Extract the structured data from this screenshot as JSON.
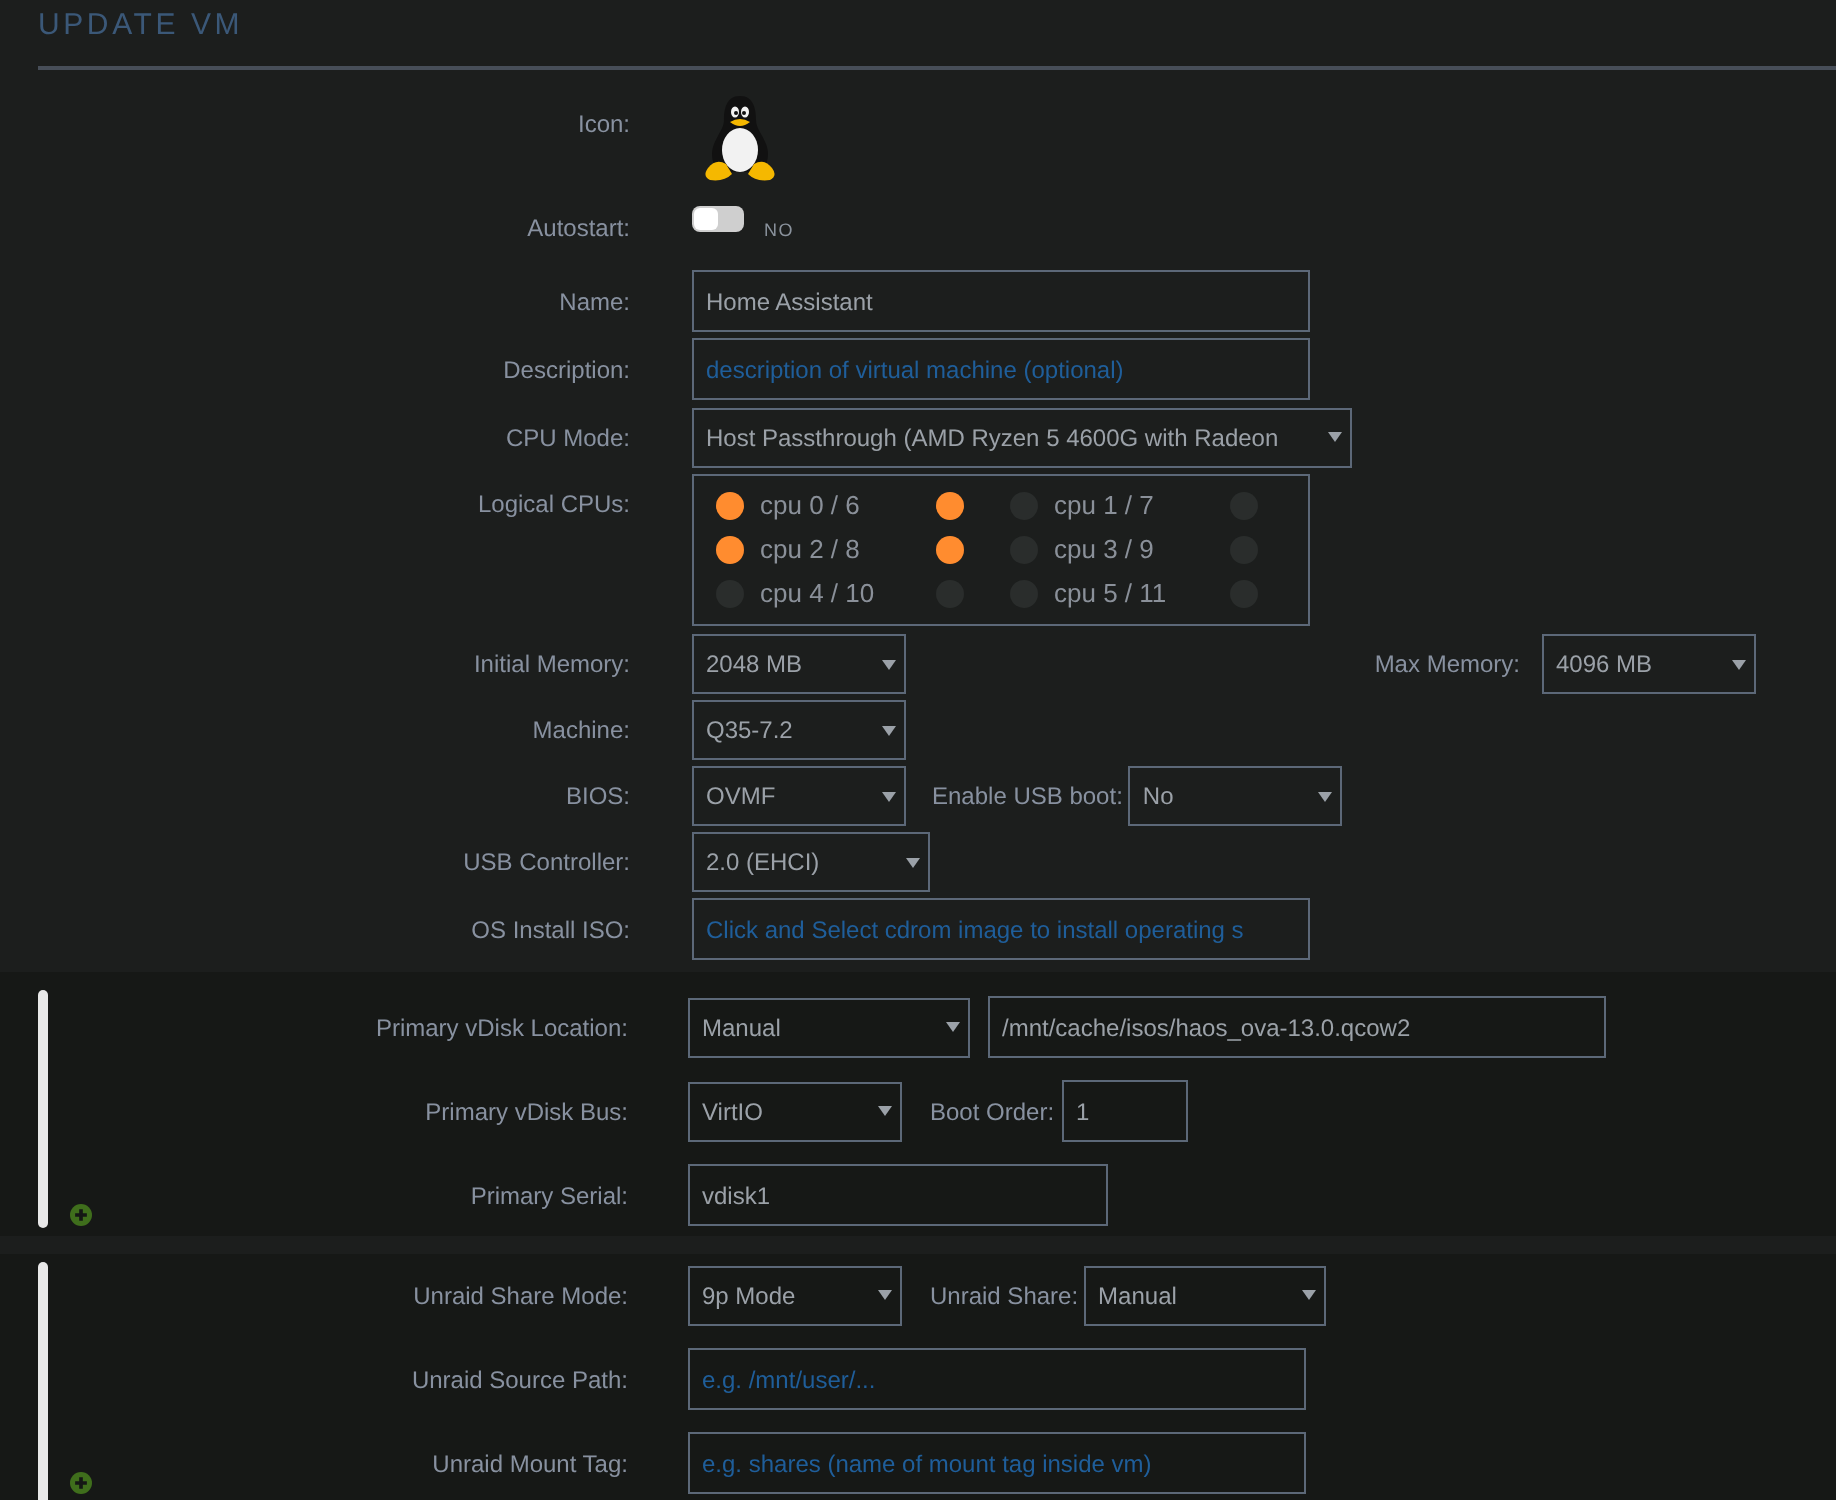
{
  "title": "UPDATE VM",
  "general": {
    "icon": {
      "label": "Icon:"
    },
    "autostart": {
      "label": "Autostart:",
      "on": false,
      "state_text": "NO"
    },
    "name": {
      "label": "Name:",
      "value": "Home Assistant"
    },
    "description": {
      "label": "Description:",
      "placeholder": "description of virtual machine (optional)"
    },
    "cpu_mode": {
      "label": "CPU Mode:",
      "value": "Host Passthrough (AMD Ryzen 5 4600G with Radeon"
    },
    "logical_cpus": {
      "label": "Logical CPUs:",
      "cpus": [
        {
          "label": "cpu 0 / 6",
          "threads": [
            {
              "checked": true
            },
            {
              "checked": true
            }
          ]
        },
        {
          "label": "cpu 1 / 7",
          "threads": [
            {
              "checked": false
            },
            {
              "checked": false
            }
          ]
        },
        {
          "label": "cpu 2 / 8",
          "threads": [
            {
              "checked": true
            },
            {
              "checked": true
            }
          ]
        },
        {
          "label": "cpu 3 / 9",
          "threads": [
            {
              "checked": false
            },
            {
              "checked": false
            }
          ]
        },
        {
          "label": "cpu 4 / 10",
          "threads": [
            {
              "checked": false
            },
            {
              "checked": false
            }
          ]
        },
        {
          "label": "cpu 5 / 11",
          "threads": [
            {
              "checked": false
            },
            {
              "checked": false
            }
          ]
        }
      ]
    },
    "initial_memory": {
      "label": "Initial Memory:",
      "value": "2048 MB"
    },
    "max_memory": {
      "label": "Max Memory:",
      "value": "4096 MB"
    },
    "machine": {
      "label": "Machine:",
      "value": "Q35-7.2"
    },
    "bios": {
      "label": "BIOS:",
      "value": "OVMF"
    },
    "usb_boot": {
      "label": "Enable USB boot:",
      "value": "No"
    },
    "usb_controller": {
      "label": "USB Controller:",
      "value": "2.0 (EHCI)"
    },
    "os_install_iso": {
      "label": "OS Install ISO:",
      "placeholder": "Click and Select cdrom image to install operating s"
    }
  },
  "vdisk": {
    "location": {
      "label": "Primary vDisk Location:",
      "value": "Manual",
      "path": "/mnt/cache/isos/haos_ova-13.0.qcow2"
    },
    "bus": {
      "label": "Primary vDisk Bus:",
      "value": "VirtIO"
    },
    "boot_order": {
      "label": "Boot Order:",
      "value": "1"
    },
    "serial": {
      "label": "Primary Serial:",
      "value": "vdisk1"
    }
  },
  "share": {
    "mode": {
      "label": "Unraid Share Mode:",
      "value": "9p Mode"
    },
    "share": {
      "label": "Unraid Share:",
      "value": "Manual"
    },
    "source_path": {
      "label": "Unraid Source Path:",
      "placeholder": "e.g. /mnt/user/..."
    },
    "mount_tag": {
      "label": "Unraid Mount Tag:",
      "placeholder": "e.g. shares (name of mount tag inside vm)"
    }
  }
}
